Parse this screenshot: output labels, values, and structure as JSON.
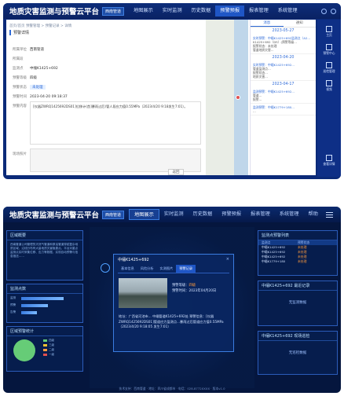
{
  "app_title": "地质灾害监测与预警云平台",
  "region": "西南管道",
  "screen1": {
    "nav": [
      "地图展示",
      "实时监测",
      "历史数据",
      "预警预报",
      "报表管理",
      "系统管理"
    ],
    "active_nav": "预警预报",
    "breadcrumb": "首页/首页  预警管理  >  预警记录  >  详情",
    "section": "预警详情",
    "fields": [
      {
        "label": "所属单位",
        "value": "西南管道"
      },
      {
        "label": "所属段",
        "value": ""
      },
      {
        "label": "监测点",
        "value": "中缅K1425+692"
      },
      {
        "label": "预警等级",
        "value": "四级"
      },
      {
        "label": "预警状态",
        "value": "未处理"
      },
      {
        "label": "预警时间",
        "value": "2023-04-20 09:18:37"
      },
      {
        "label": "预警内容",
        "value": "[仪器ZWRQ1425692DS01]位移计(首]暴雨过后)管人段应力值0.55MPa（2023/4/20 9:18发生7:01）。"
      },
      {
        "label": "现场照片",
        "value": ""
      }
    ],
    "back_button": "返回",
    "msg_tabs": [
      "消息",
      "通知"
    ],
    "messages": [
      {
        "date": "2023-05-27",
        "lines": [
          "实时预警：中缅K1425+692监测点（A2…",
          "K1425+692（DS）(预警等级…",
          "报警状态：未处理",
          "管道地质灾害…"
        ]
      },
      {
        "date": "2023-04-20",
        "lines": [
          "实时预警：中缅K1425+692…",
          "管道监测点…",
          "报警状态…",
          "地质灾害…"
        ]
      },
      {
        "date": "2023-04-17",
        "lines": [
          "监测预警：中缅K1425+692…",
          "管道…",
          "报警…"
        ]
      },
      {
        "date": "",
        "lines": [
          "监测预警：中缅K1779+180…",
          "…"
        ]
      }
    ],
    "side_items": [
      "主页",
      "预警中心",
      "巡检管理",
      "视频",
      "查看详情"
    ]
  },
  "screen2": {
    "nav": [
      "地图展示",
      "实时监测",
      "历史数据",
      "预警预报",
      "报表管理",
      "系统管理",
      "帮助"
    ],
    "active_nav": "地图展示",
    "left_panels": [
      "区域概要",
      "监测点数",
      "区域预警统计"
    ],
    "overview_text": "西南管道公司管理的天然气管道和原油管道穿越复杂地质区域，沿线分布有大量地质灾害隐患点。平台对重点监测点实时采集位移、应力等数据，实现自动预警与信息推送……",
    "bars": [
      {
        "name": "监测",
        "value": 0.8
      },
      {
        "name": "预警",
        "value": 0.5
      },
      {
        "name": "告警",
        "value": 0.3
      }
    ],
    "legend": [
      "四级",
      "三级",
      "二级",
      "一级"
    ],
    "legend_colors": [
      "#66cc77",
      "#f1c232",
      "#ff9b3d",
      "#e05050"
    ],
    "popup": {
      "title": "中缅K1425+692",
      "close": "×",
      "tabs": [
        "基本信息",
        "风险分析",
        "实测图片",
        "预警记录"
      ],
      "active_tab": "预警记录",
      "level_label": "预警等级：",
      "level": "四级",
      "time_label": "预警时间：",
      "time": "2023年04月20日",
      "desc": "地址：广西省河池市... 中缅管道K1425+692处\n预警信息：[仪器ZWRQ1425692DS01]管道应力监测点...暴雨过后管道应力值0.55MPa（2023/4/20 9:18:05 发生7:01）"
    },
    "right_panels": [
      "监测点预警列表",
      "中缅K1425+692 最近记录",
      "中缅K1425+692 现场巡检"
    ],
    "table_head": [
      "监测点",
      "预警状态"
    ],
    "table_rows": [
      [
        "中缅K1425+692",
        "未处理"
      ],
      [
        "中缅K1425+692",
        "未处理"
      ],
      [
        "中缅K1425+692",
        "未处理"
      ],
      [
        "中缅K1779+180",
        "未处理"
      ]
    ],
    "empty_text": "无监测数据",
    "empty_text2": "无巡检数据",
    "footer": "技术支持：西南管道 · 地址：四川省成都市 · 电话：028-8772XXXX · 版本v1.0"
  }
}
